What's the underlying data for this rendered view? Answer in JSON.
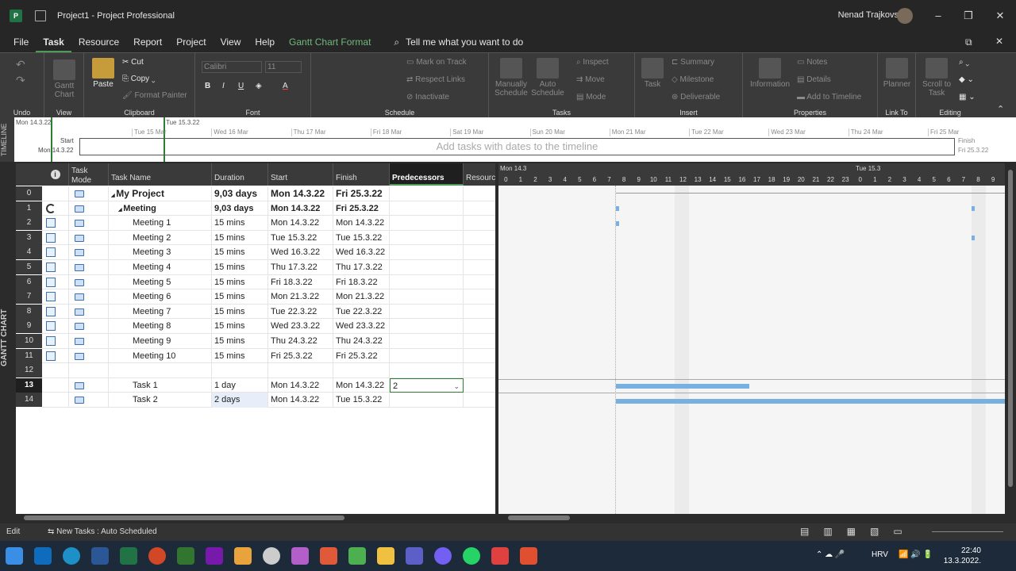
{
  "title": "Project1  -  Project Professional",
  "user": "Nenad Trajkovski",
  "menu": [
    "File",
    "Task",
    "Resource",
    "Report",
    "Project",
    "View",
    "Help",
    "Gantt Chart Format"
  ],
  "tell_me": "Tell me what you want to do",
  "ribbon": {
    "groups": [
      "Undo",
      "View",
      "Clipboard",
      "Font",
      "Schedule",
      "Tasks",
      "Insert",
      "Properties",
      "Link To",
      "Editing"
    ],
    "clipboard": {
      "paste": "Paste",
      "cut": "Cut",
      "copy": "Copy",
      "format_painter": "Format Painter"
    },
    "view": {
      "gantt": "Gantt Chart"
    },
    "font": {
      "name": "Calibri",
      "size": "11"
    },
    "schedule": {
      "mark": "Mark on Track",
      "respect": "Respect Links",
      "inactivate": "Inactivate"
    },
    "tasks": {
      "manual": "Manually Schedule",
      "auto": "Auto Schedule",
      "inspect": "Inspect",
      "move": "Move",
      "mode": "Mode"
    },
    "insert": {
      "task": "Task",
      "summary": "Summary",
      "milestone": "Milestone",
      "deliverable": "Deliverable"
    },
    "properties": {
      "information": "Information",
      "notes": "Notes",
      "details": "Details",
      "add_timeline": "Add to Timeline"
    },
    "linkto": {
      "planner": "Planner"
    },
    "editing": {
      "scroll": "Scroll to Task"
    }
  },
  "timeline": {
    "side_label": "TIMELINE",
    "start_label": "Start",
    "start_date": "Mon 14.3.22",
    "top_left": "Mon 14.3.22",
    "top_marker": "Tue 15.3.22",
    "finish_label": "Finish",
    "finish_date": "Fri 25.3.22",
    "placeholder": "Add tasks with dates to the timeline",
    "dates": [
      "Tue 15 Mar",
      "Wed 16 Mar",
      "Thu 17 Mar",
      "Fri 18 Mar",
      "Sat 19 Mar",
      "Sun 20 Mar",
      "Mon 21 Mar",
      "Tue 22 Mar",
      "Wed 23 Mar",
      "Thu 24 Mar",
      "Fri 25 Mar"
    ]
  },
  "view_label": "GANTT CHART",
  "columns": {
    "info": "i",
    "mode": "Task Mode",
    "name": "Task Name",
    "duration": "Duration",
    "start": "Start",
    "finish": "Finish",
    "pred": "Predecessors",
    "resource": "Resourc"
  },
  "rows": [
    {
      "n": "0",
      "name": "My Project",
      "dur": "9,03 days",
      "start": "Mon 14.3.22",
      "finish": "Fri 25.3.22",
      "pred": ""
    },
    {
      "n": "1",
      "name": "Meeting",
      "dur": "9,03 days",
      "start": "Mon 14.3.22",
      "finish": "Fri 25.3.22",
      "pred": ""
    },
    {
      "n": "2",
      "name": "Meeting 1",
      "dur": "15 mins",
      "start": "Mon 14.3.22",
      "finish": "Mon 14.3.22",
      "pred": ""
    },
    {
      "n": "3",
      "name": "Meeting 2",
      "dur": "15 mins",
      "start": "Tue 15.3.22",
      "finish": "Tue 15.3.22",
      "pred": ""
    },
    {
      "n": "4",
      "name": "Meeting 3",
      "dur": "15 mins",
      "start": "Wed 16.3.22",
      "finish": "Wed 16.3.22",
      "pred": ""
    },
    {
      "n": "5",
      "name": "Meeting 4",
      "dur": "15 mins",
      "start": "Thu 17.3.22",
      "finish": "Thu 17.3.22",
      "pred": ""
    },
    {
      "n": "6",
      "name": "Meeting 5",
      "dur": "15 mins",
      "start": "Fri 18.3.22",
      "finish": "Fri 18.3.22",
      "pred": ""
    },
    {
      "n": "7",
      "name": "Meeting 6",
      "dur": "15 mins",
      "start": "Mon 21.3.22",
      "finish": "Mon 21.3.22",
      "pred": ""
    },
    {
      "n": "8",
      "name": "Meeting 7",
      "dur": "15 mins",
      "start": "Tue 22.3.22",
      "finish": "Tue 22.3.22",
      "pred": ""
    },
    {
      "n": "9",
      "name": "Meeting 8",
      "dur": "15 mins",
      "start": "Wed 23.3.22",
      "finish": "Wed 23.3.22",
      "pred": ""
    },
    {
      "n": "10",
      "name": "Meeting 9",
      "dur": "15 mins",
      "start": "Thu 24.3.22",
      "finish": "Thu 24.3.22",
      "pred": ""
    },
    {
      "n": "11",
      "name": "Meeting 10",
      "dur": "15 mins",
      "start": "Fri 25.3.22",
      "finish": "Fri 25.3.22",
      "pred": ""
    },
    {
      "n": "12",
      "name": "",
      "dur": "",
      "start": "",
      "finish": "",
      "pred": ""
    },
    {
      "n": "13",
      "name": "Task 1",
      "dur": "1 day",
      "start": "Mon 14.3.22",
      "finish": "Mon 14.3.22",
      "pred": "2"
    },
    {
      "n": "14",
      "name": "Task 2",
      "dur": "2 days",
      "start": "Mon 14.3.22",
      "finish": "Tue 15.3.22",
      "pred": ""
    }
  ],
  "chart_header": {
    "day1": "Mon 14.3",
    "day2": "Tue 15.3",
    "hours": [
      "0",
      "1",
      "2",
      "3",
      "4",
      "5",
      "6",
      "7",
      "8",
      "9",
      "10",
      "11",
      "12",
      "13",
      "14",
      "15",
      "16",
      "17",
      "18",
      "19",
      "20",
      "21",
      "22",
      "23",
      "0",
      "1",
      "2",
      "3",
      "4",
      "5",
      "6",
      "7",
      "8",
      "9"
    ]
  },
  "status": {
    "mode": "Edit",
    "new_tasks": "New Tasks : Auto Scheduled"
  },
  "taskbar": {
    "lang": "HRV",
    "time": "22:40",
    "date": "13.3.2022."
  }
}
